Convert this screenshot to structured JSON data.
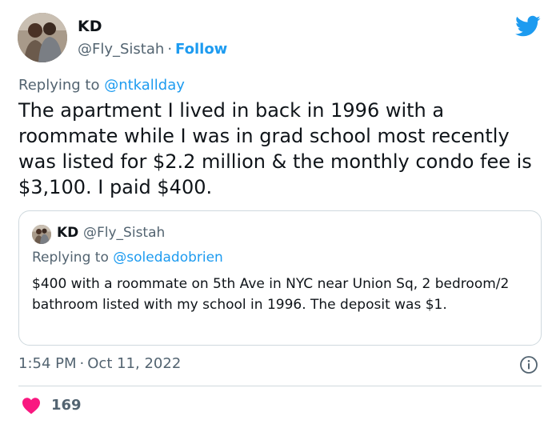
{
  "author": {
    "name": "KD",
    "handle": "@Fly_Sistah",
    "separator": "·",
    "follow_label": "Follow"
  },
  "reply": {
    "prefix": "Replying to ",
    "mention": "@ntkallday"
  },
  "tweet_text": "The apartment I lived in back in 1996 with a roommate while I was in grad school most recently was listed for $2.2 million & the monthly condo fee is $3,100. I paid $400.",
  "quote": {
    "name": "KD",
    "handle": "@Fly_Sistah",
    "reply_prefix": "Replying to ",
    "reply_mention": "@soledadobrien",
    "text": "$400 with a roommate on 5th Ave in NYC near Union Sq, 2 bedroom/2 bathroom listed with my school in 1996. The deposit was $1."
  },
  "timestamp": {
    "time": "1:54 PM",
    "separator": "·",
    "date": "Oct 11, 2022"
  },
  "likes": {
    "count": "169"
  },
  "icons": {
    "brand": "twitter-bird-icon",
    "info": "info-icon",
    "like": "heart-icon"
  },
  "colors": {
    "accent": "#1d9bf0",
    "text": "#0f1419",
    "secondary": "#536471",
    "like": "#f91880",
    "border": "#cfd9de"
  }
}
